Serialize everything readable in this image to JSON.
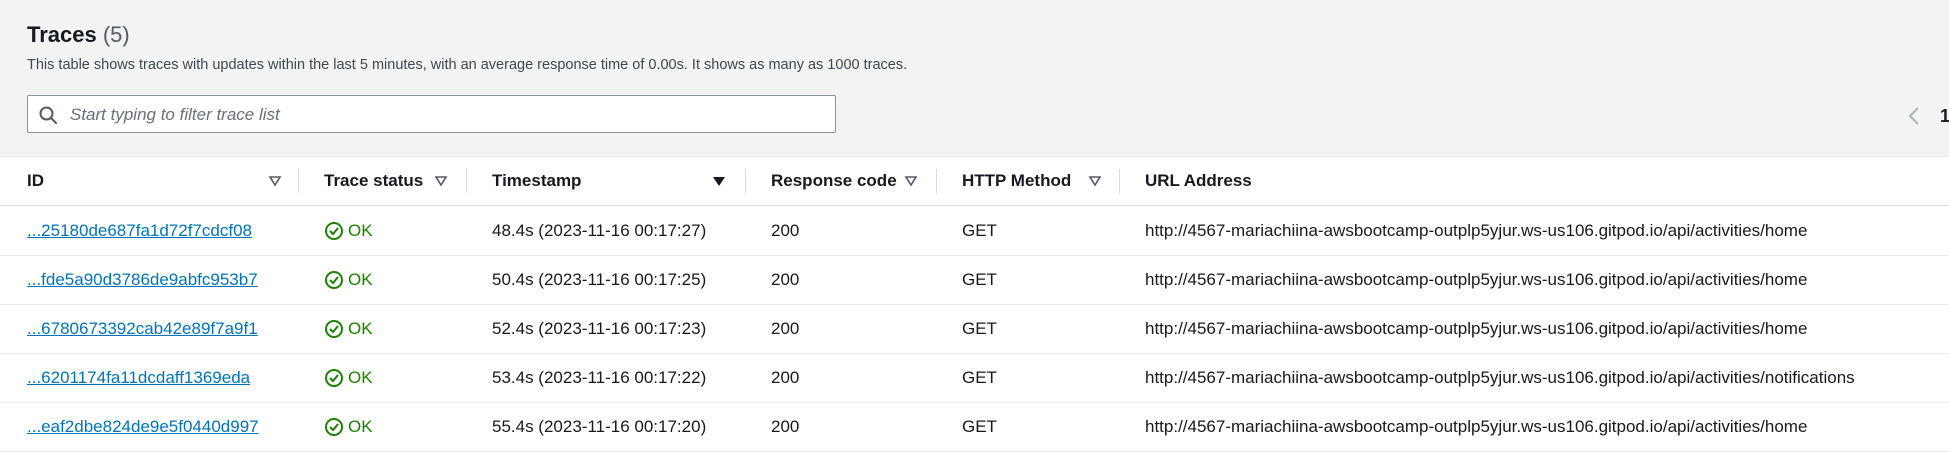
{
  "header": {
    "title": "Traces",
    "count": "(5)",
    "description": "This table shows traces with updates within the last 5 minutes, with an average response time of 0.00s. It shows as many as 1000 traces."
  },
  "filter": {
    "placeholder": "Start typing to filter trace list",
    "value": ""
  },
  "pagination": {
    "current_page": "1"
  },
  "table": {
    "columns": [
      {
        "key": "id",
        "label": "ID"
      },
      {
        "key": "status",
        "label": "Trace status"
      },
      {
        "key": "timestamp",
        "label": "Timestamp"
      },
      {
        "key": "response_code",
        "label": "Response code"
      },
      {
        "key": "method",
        "label": "HTTP Method"
      },
      {
        "key": "url",
        "label": "URL Address"
      }
    ],
    "rows": [
      {
        "id": "...25180de687fa1d72f7cdcf08",
        "status": "OK",
        "timestamp": "48.4s (2023-11-16 00:17:27)",
        "response_code": "200",
        "method": "GET",
        "url": "http://4567-mariachiina-awsbootcamp-outplp5yjur.ws-us106.gitpod.io/api/activities/home"
      },
      {
        "id": "...fde5a90d3786de9abfc953b7",
        "status": "OK",
        "timestamp": "50.4s (2023-11-16 00:17:25)",
        "response_code": "200",
        "method": "GET",
        "url": "http://4567-mariachiina-awsbootcamp-outplp5yjur.ws-us106.gitpod.io/api/activities/home"
      },
      {
        "id": "...6780673392cab42e89f7a9f1",
        "status": "OK",
        "timestamp": "52.4s (2023-11-16 00:17:23)",
        "response_code": "200",
        "method": "GET",
        "url": "http://4567-mariachiina-awsbootcamp-outplp5yjur.ws-us106.gitpod.io/api/activities/home"
      },
      {
        "id": "...6201174fa11dcdaff1369eda",
        "status": "OK",
        "timestamp": "53.4s (2023-11-16 00:17:22)",
        "response_code": "200",
        "method": "GET",
        "url": "http://4567-mariachiina-awsbootcamp-outplp5yjur.ws-us106.gitpod.io/api/activities/notifications"
      },
      {
        "id": "...eaf2dbe824de9e5f0440d997",
        "status": "OK",
        "timestamp": "55.4s (2023-11-16 00:17:20)",
        "response_code": "200",
        "method": "GET",
        "url": "http://4567-mariachiina-awsbootcamp-outplp5yjur.ws-us106.gitpod.io/api/activities/home"
      }
    ]
  },
  "colors": {
    "link": "#0073bb",
    "ok_status": "#1d8102",
    "background": "#f2f3f3"
  }
}
